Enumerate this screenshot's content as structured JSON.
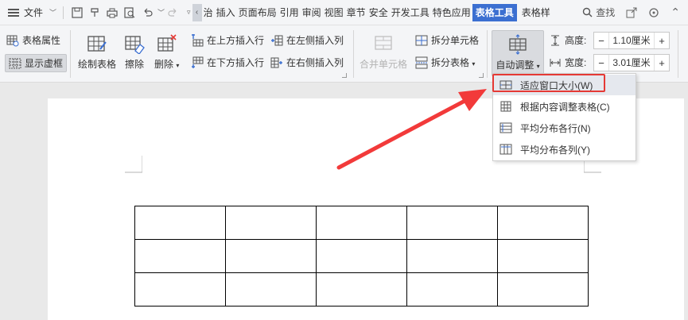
{
  "menubar": {
    "file_label": "文件",
    "tabs": [
      "治",
      "插入",
      "页面布局",
      "引用",
      "审阅",
      "视图",
      "章节",
      "安全",
      "开发工具",
      "特色应用",
      "表格工具",
      "表格样"
    ],
    "active_tab_index": 10,
    "search_label": "查找",
    "accent_color": "#3b6fd1"
  },
  "ribbon": {
    "table_props": "表格属性",
    "show_gridlines": "显示虚框",
    "draw_table": "绘制表格",
    "erase": "擦除",
    "delete": "删除",
    "insert_above": "在上方插入行",
    "insert_below": "在下方插入行",
    "insert_left": "在左侧插入列",
    "insert_right": "在右侧插入列",
    "merge_cells": "合并单元格",
    "split_cells": "拆分单元格",
    "split_table": "拆分表格",
    "auto_fit": "自动调整",
    "height_label": "高度:",
    "height_value": "1.10厘米",
    "width_label": "宽度:",
    "width_value": "3.01厘米"
  },
  "dropdown": {
    "items": [
      "适应窗口大小(W)",
      "根据内容调整表格(C)",
      "平均分布各行(N)",
      "平均分布各列(Y)"
    ],
    "highlighted_index": 0,
    "highlight_color": "#e53935"
  },
  "table": {
    "rows": 3,
    "cols": 5
  }
}
